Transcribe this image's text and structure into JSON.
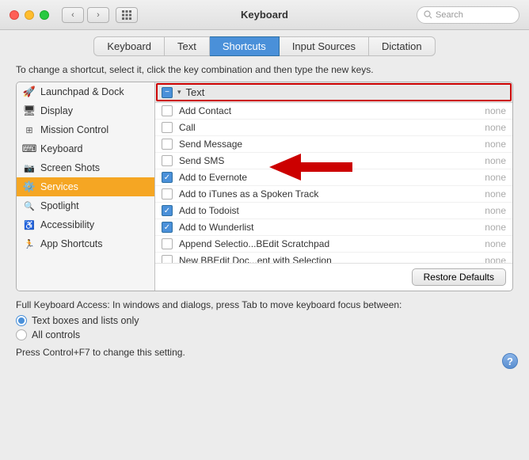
{
  "window": {
    "title": "Keyboard"
  },
  "titlebar": {
    "search_placeholder": "Search"
  },
  "tabs": [
    {
      "id": "keyboard",
      "label": "Keyboard",
      "active": false
    },
    {
      "id": "text",
      "label": "Text",
      "active": false
    },
    {
      "id": "shortcuts",
      "label": "Shortcuts",
      "active": true
    },
    {
      "id": "input-sources",
      "label": "Input Sources",
      "active": false
    },
    {
      "id": "dictation",
      "label": "Dictation",
      "active": false
    }
  ],
  "instruction": "To change a shortcut, select it, click the key combination and then type the new keys.",
  "sidebar_items": [
    {
      "id": "launchpad",
      "label": "Launchpad & Dock",
      "icon": "🚀",
      "selected": false
    },
    {
      "id": "display",
      "label": "Display",
      "icon": "🖥",
      "selected": false
    },
    {
      "id": "mission-control",
      "label": "Mission Control",
      "icon": "⊞",
      "selected": false
    },
    {
      "id": "keyboard",
      "label": "Keyboard",
      "icon": "⌨",
      "selected": false
    },
    {
      "id": "screenshots",
      "label": "Screen Shots",
      "icon": "📷",
      "selected": false
    },
    {
      "id": "services",
      "label": "Services",
      "icon": "⚙",
      "selected": true
    },
    {
      "id": "spotlight",
      "label": "Spotlight",
      "icon": "🔦",
      "selected": false
    },
    {
      "id": "accessibility",
      "label": "Accessibility",
      "icon": "♿",
      "selected": false
    },
    {
      "id": "app-shortcuts",
      "label": "App Shortcuts",
      "icon": "🏃",
      "selected": false
    }
  ],
  "group": {
    "label": "Text",
    "checked": true
  },
  "shortcuts": [
    {
      "id": "add-contact",
      "label": "Add Contact",
      "shortcut": "none",
      "checked": false
    },
    {
      "id": "call",
      "label": "Call",
      "shortcut": "none",
      "checked": false
    },
    {
      "id": "send-message",
      "label": "Send Message",
      "shortcut": "none",
      "checked": false
    },
    {
      "id": "send-sms",
      "label": "Send SMS",
      "shortcut": "none",
      "checked": false
    },
    {
      "id": "add-evernote",
      "label": "Add to Evernote",
      "shortcut": "none",
      "checked": true
    },
    {
      "id": "add-itunes",
      "label": "Add to iTunes as a Spoken Track",
      "shortcut": "none",
      "checked": false
    },
    {
      "id": "add-todoist",
      "label": "Add to Todoist",
      "shortcut": "none",
      "checked": true
    },
    {
      "id": "add-wunderlist",
      "label": "Add to Wunderlist",
      "shortcut": "none",
      "checked": true
    },
    {
      "id": "append-bbedit",
      "label": "Append Selectio...BEdit Scratchpad",
      "shortcut": "none",
      "checked": false
    },
    {
      "id": "new-bbedit",
      "label": "New BBEdit Doc...ent with Selection",
      "shortcut": "none",
      "checked": false
    }
  ],
  "buttons": {
    "restore_defaults": "Restore Defaults"
  },
  "bottom": {
    "description": "Full Keyboard Access: In windows and dialogs, press Tab to move keyboard focus between:",
    "radio_options": [
      {
        "id": "text-boxes",
        "label": "Text boxes and lists only",
        "selected": true
      },
      {
        "id": "all-controls",
        "label": "All controls",
        "selected": false
      }
    ],
    "hint": "Press Control+F7 to change this setting."
  }
}
